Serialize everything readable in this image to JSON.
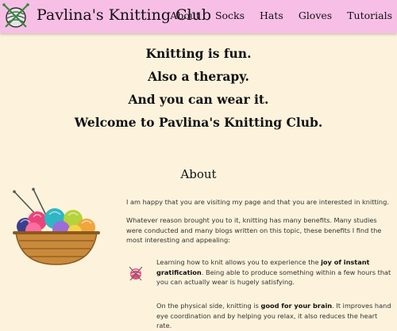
{
  "header": {
    "brand": "Pavlina's Knitting Club",
    "nav": [
      "About",
      "Socks",
      "Hats",
      "Gloves",
      "Tutorials"
    ]
  },
  "hero": {
    "lines": [
      "Knitting is fun.",
      "Also a therapy.",
      "And you can wear it.",
      "Welcome to Pavlina's Knitting Club."
    ]
  },
  "about": {
    "title": "About",
    "intro": "I am happy that you are visiting my page and that you are interested in knitting.",
    "paragraph": "Whatever reason brought you to it, knitting has many benefits. Many studies were conducted and many blogs written on this topic, these benefits I find the most interesting and appealing:",
    "benefits": [
      {
        "pre": "Learning how to knit allows you to experience the ",
        "bold": "joy of instant gratification",
        "post": ". Being able to produce something within a few hours that you can actually wear is hugely satisfying."
      },
      {
        "pre": "On the physical side, knitting is ",
        "bold": "good for your brain",
        "post": ". It improves hand eye coordination and by helping you relax, it also reduces the heart rate."
      }
    ]
  },
  "colors": {
    "nav_background": "#f8bfe6",
    "page_background": "#fdf3dc"
  },
  "icons": [
    "knitting-logo-icon",
    "yarn-basket-image",
    "yarn-ball-icon"
  ]
}
